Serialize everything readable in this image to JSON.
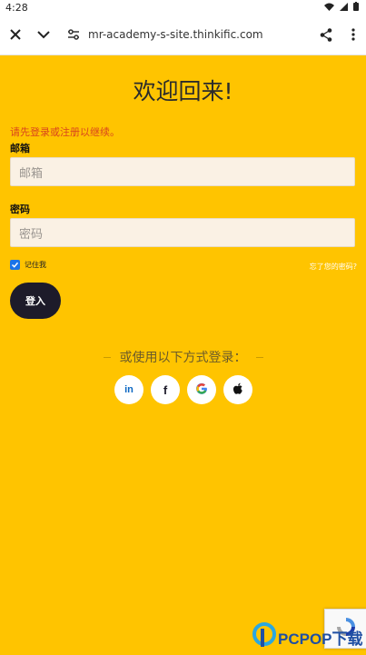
{
  "status": {
    "time": "4:28"
  },
  "browser": {
    "url": "mr-academy-s-site.thinkific.com"
  },
  "login": {
    "title": "欢迎回来!",
    "notice": "请先登录或注册以继续。",
    "email_label": "邮箱",
    "email_placeholder": "邮箱",
    "password_label": "密码",
    "password_placeholder": "密码",
    "remember_label": "记住我",
    "remember_checked": true,
    "forgot_link": "忘了您的密码?",
    "submit_label": "登入",
    "alt_login_label": "或使用以下方式登录：",
    "social": [
      {
        "icon": "linkedin-icon",
        "text": "in"
      },
      {
        "icon": "facebook-icon",
        "text": "f"
      },
      {
        "icon": "google-icon"
      },
      {
        "icon": "apple-icon"
      }
    ]
  },
  "watermark": {
    "text": "PCPOP下载"
  },
  "colors": {
    "page_background": "#FFC400",
    "notice": "#D9441E",
    "button": "#1d1b2a",
    "input_background": "#FAF1E4"
  }
}
